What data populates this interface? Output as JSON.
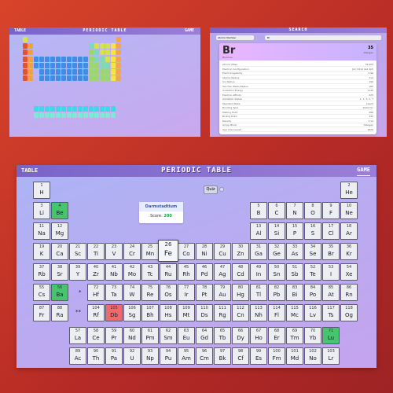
{
  "mini_table": {
    "header": {
      "left": "TABLE",
      "title": "PERIODIC TABLE",
      "right": "GAME"
    }
  },
  "search_panel": {
    "header": {
      "title": "SEARCH"
    },
    "dropdown": "Atomic Number",
    "search_value": "Br",
    "card": {
      "symbol": "Br",
      "number": "35",
      "name": "Bromine",
      "category": "Halogen",
      "rows": [
        {
          "label": "Atomic Mass",
          "value": "79.904"
        },
        {
          "label": "Electron Configuration",
          "value": "[Ar] 3d10 4s2 4p5"
        },
        {
          "label": "Electronegativity",
          "value": "2.96"
        },
        {
          "label": "Atomic Radius",
          "value": "114"
        },
        {
          "label": "Ion Radius",
          "value": "196"
        },
        {
          "label": "Van Der Waals Radius",
          "value": "185"
        },
        {
          "label": "Ionization Energy",
          "value": "1140"
        },
        {
          "label": "Electron Affinity",
          "value": "-325"
        },
        {
          "label": "Oxidation States",
          "value": "-1, 1, 3, 5, 7"
        },
        {
          "label": "Standard State",
          "value": "Liquid"
        },
        {
          "label": "Bonding Type",
          "value": "Diatomic"
        },
        {
          "label": "Melting Point",
          "value": "266"
        },
        {
          "label": "Boiling Point",
          "value": "332"
        },
        {
          "label": "Density",
          "value": "3.12"
        },
        {
          "label": "Group Block",
          "value": "Halogen"
        },
        {
          "label": "Year Discovered",
          "value": "1826"
        }
      ]
    }
  },
  "main": {
    "header": {
      "left": "TABLE",
      "title": "PERIODIC TABLE",
      "right": "GAME"
    },
    "quiz_label": "Quiz",
    "info": {
      "element": "Darmstadtium",
      "score_label": "Score:",
      "score_value": "200"
    },
    "lanthanide_marker": "*",
    "actinide_marker": "**",
    "highlight_colors": {
      "correct": "#46c46e",
      "wrong": "#ef6b6b"
    },
    "elements": [
      {
        "n": "1",
        "s": "H"
      },
      {
        "n": "2",
        "s": "He"
      },
      {
        "n": "3",
        "s": "Li"
      },
      {
        "n": "4",
        "s": "Be",
        "c": "green"
      },
      {
        "n": "5",
        "s": "B"
      },
      {
        "n": "6",
        "s": "C"
      },
      {
        "n": "7",
        "s": "N"
      },
      {
        "n": "8",
        "s": "O"
      },
      {
        "n": "9",
        "s": "F"
      },
      {
        "n": "10",
        "s": "Ne"
      },
      {
        "n": "11",
        "s": "Na"
      },
      {
        "n": "12",
        "s": "Mg"
      },
      {
        "n": "13",
        "s": "Al"
      },
      {
        "n": "14",
        "s": "Si"
      },
      {
        "n": "15",
        "s": "P"
      },
      {
        "n": "16",
        "s": "S"
      },
      {
        "n": "17",
        "s": "Cl"
      },
      {
        "n": "18",
        "s": "Ar"
      },
      {
        "n": "19",
        "s": "K"
      },
      {
        "n": "20",
        "s": "Ca"
      },
      {
        "n": "21",
        "s": "Sc"
      },
      {
        "n": "22",
        "s": "Ti"
      },
      {
        "n": "23",
        "s": "V"
      },
      {
        "n": "24",
        "s": "Cr"
      },
      {
        "n": "25",
        "s": "Mn"
      },
      {
        "n": "26",
        "s": "Fe",
        "c": "big"
      },
      {
        "n": "27",
        "s": "Co"
      },
      {
        "n": "28",
        "s": "Ni"
      },
      {
        "n": "29",
        "s": "Cu"
      },
      {
        "n": "30",
        "s": "Zn"
      },
      {
        "n": "31",
        "s": "Ga"
      },
      {
        "n": "32",
        "s": "Ge"
      },
      {
        "n": "33",
        "s": "As"
      },
      {
        "n": "34",
        "s": "Se"
      },
      {
        "n": "35",
        "s": "Br"
      },
      {
        "n": "36",
        "s": "Kr"
      },
      {
        "n": "37",
        "s": "Rb"
      },
      {
        "n": "38",
        "s": "Sr"
      },
      {
        "n": "39",
        "s": "Y"
      },
      {
        "n": "40",
        "s": "Zr"
      },
      {
        "n": "41",
        "s": "Nb"
      },
      {
        "n": "42",
        "s": "Mo"
      },
      {
        "n": "43",
        "s": "Tc"
      },
      {
        "n": "44",
        "s": "Ru"
      },
      {
        "n": "45",
        "s": "Rh"
      },
      {
        "n": "46",
        "s": "Pd"
      },
      {
        "n": "47",
        "s": "Ag"
      },
      {
        "n": "48",
        "s": "Cd"
      },
      {
        "n": "49",
        "s": "In"
      },
      {
        "n": "50",
        "s": "Sn"
      },
      {
        "n": "51",
        "s": "Sb"
      },
      {
        "n": "52",
        "s": "Te"
      },
      {
        "n": "53",
        "s": "I"
      },
      {
        "n": "54",
        "s": "Xe"
      },
      {
        "n": "55",
        "s": "Cs"
      },
      {
        "n": "56",
        "s": "Ba",
        "c": "green"
      },
      {
        "n": "72",
        "s": "Hf"
      },
      {
        "n": "73",
        "s": "Ta"
      },
      {
        "n": "74",
        "s": "W"
      },
      {
        "n": "75",
        "s": "Re"
      },
      {
        "n": "76",
        "s": "Os"
      },
      {
        "n": "77",
        "s": "Ir"
      },
      {
        "n": "78",
        "s": "Pt"
      },
      {
        "n": "79",
        "s": "Au"
      },
      {
        "n": "80",
        "s": "Hg"
      },
      {
        "n": "81",
        "s": "Tl"
      },
      {
        "n": "82",
        "s": "Pb"
      },
      {
        "n": "83",
        "s": "Bi"
      },
      {
        "n": "84",
        "s": "Po"
      },
      {
        "n": "85",
        "s": "At"
      },
      {
        "n": "86",
        "s": "Rn"
      },
      {
        "n": "87",
        "s": "Fr"
      },
      {
        "n": "88",
        "s": "Ra"
      },
      {
        "n": "104",
        "s": "Rf"
      },
      {
        "n": "105",
        "s": "Db",
        "c": "red"
      },
      {
        "n": "106",
        "s": "Sg"
      },
      {
        "n": "107",
        "s": "Bh"
      },
      {
        "n": "108",
        "s": "Hs"
      },
      {
        "n": "109",
        "s": "Mt"
      },
      {
        "n": "110",
        "s": "Ds"
      },
      {
        "n": "111",
        "s": "Rg"
      },
      {
        "n": "112",
        "s": "Cn"
      },
      {
        "n": "113",
        "s": "Nh"
      },
      {
        "n": "114",
        "s": "Fl"
      },
      {
        "n": "115",
        "s": "Mc"
      },
      {
        "n": "116",
        "s": "Lv"
      },
      {
        "n": "117",
        "s": "Ts"
      },
      {
        "n": "118",
        "s": "Og"
      },
      {
        "n": "57",
        "s": "La"
      },
      {
        "n": "58",
        "s": "Ce"
      },
      {
        "n": "59",
        "s": "Pr"
      },
      {
        "n": "60",
        "s": "Nd"
      },
      {
        "n": "61",
        "s": "Pm"
      },
      {
        "n": "62",
        "s": "Sm"
      },
      {
        "n": "63",
        "s": "Eu"
      },
      {
        "n": "64",
        "s": "Gd"
      },
      {
        "n": "65",
        "s": "Tb"
      },
      {
        "n": "66",
        "s": "Dy"
      },
      {
        "n": "67",
        "s": "Ho"
      },
      {
        "n": "68",
        "s": "Er"
      },
      {
        "n": "69",
        "s": "Tm"
      },
      {
        "n": "70",
        "s": "Yb"
      },
      {
        "n": "71",
        "s": "Lu",
        "c": "green"
      },
      {
        "n": "89",
        "s": "Ac"
      },
      {
        "n": "90",
        "s": "Th"
      },
      {
        "n": "91",
        "s": "Pa"
      },
      {
        "n": "92",
        "s": "U"
      },
      {
        "n": "93",
        "s": "Np"
      },
      {
        "n": "94",
        "s": "Pu"
      },
      {
        "n": "95",
        "s": "Am"
      },
      {
        "n": "96",
        "s": "Cm"
      },
      {
        "n": "97",
        "s": "Bk"
      },
      {
        "n": "98",
        "s": "Cf"
      },
      {
        "n": "99",
        "s": "Es"
      },
      {
        "n": "100",
        "s": "Fm"
      },
      {
        "n": "101",
        "s": "Md"
      },
      {
        "n": "102",
        "s": "No"
      },
      {
        "n": "103",
        "s": "Lr"
      }
    ]
  }
}
